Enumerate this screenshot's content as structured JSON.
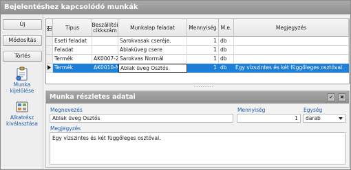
{
  "window": {
    "title": "Bejelentéshez kapcsolódó munkák"
  },
  "sidebar": {
    "buttons": [
      {
        "label": "Új"
      },
      {
        "label": "Módosítás"
      },
      {
        "label": "Törlés"
      }
    ],
    "actions": [
      {
        "label_line1": "Munka",
        "label_line2": "kijelölése",
        "icon": "task-select-icon"
      },
      {
        "label_line1": "Alkatrész",
        "label_line2": "kiválasztása",
        "icon": "part-select-icon"
      }
    ]
  },
  "grid": {
    "columns": {
      "tipus": "Típus",
      "cikkszam": "Beszállítói cikkszám",
      "munkalap": "Munkalap feladat",
      "mennyiseg": "Mennyiség",
      "me": "M.e.",
      "megjegyzes": "Megjegyzés"
    },
    "rows": [
      {
        "tipus": "Eseti feladat",
        "cikkszam": "",
        "munkalap": "Sarokvasak cseréje.",
        "mennyiseg": "1",
        "me": "db",
        "megjegyzes": ""
      },
      {
        "tipus": "Feladat",
        "cikkszam": "",
        "munkalap": "Ablaküveg csere",
        "mennyiseg": "1",
        "me": "db",
        "megjegyzes": ""
      },
      {
        "tipus": "Termék",
        "cikkszam": "AK0007-2",
        "munkalap": "Sarokvas Normál",
        "mennyiseg": "1",
        "me": "db",
        "megjegyzes": ""
      },
      {
        "tipus": "Termék",
        "cikkszam": "AK0010-N",
        "munkalap": "Ablak üveg Osztós",
        "mennyiseg": "1",
        "me": "db",
        "megjegyzes": "Egy vízszintes és két függőleges osztóval."
      }
    ],
    "splitter_glyph": "·········"
  },
  "detail": {
    "title": "Munka részletes adatai",
    "labels": {
      "megnevezes": "Megnevezés",
      "mennyiseg": "Mennyiség",
      "egyseg": "Egység",
      "megjegyzes": "Megjegyzés"
    },
    "values": {
      "megnevezes": "Ablak üveg Osztós",
      "mennyiseg": "1",
      "egyseg": "darab",
      "megjegyzes": "Egy vízszintes és két függőleges osztóval."
    },
    "header_buttons": [
      {
        "glyph": "✔",
        "icon": "confirm-icon"
      },
      {
        "glyph": "✖",
        "icon": "close-icon"
      }
    ]
  },
  "colors": {
    "titlebar": "#999999",
    "selection": "#1e7fd8",
    "label_blue": "#1a5aa8"
  }
}
